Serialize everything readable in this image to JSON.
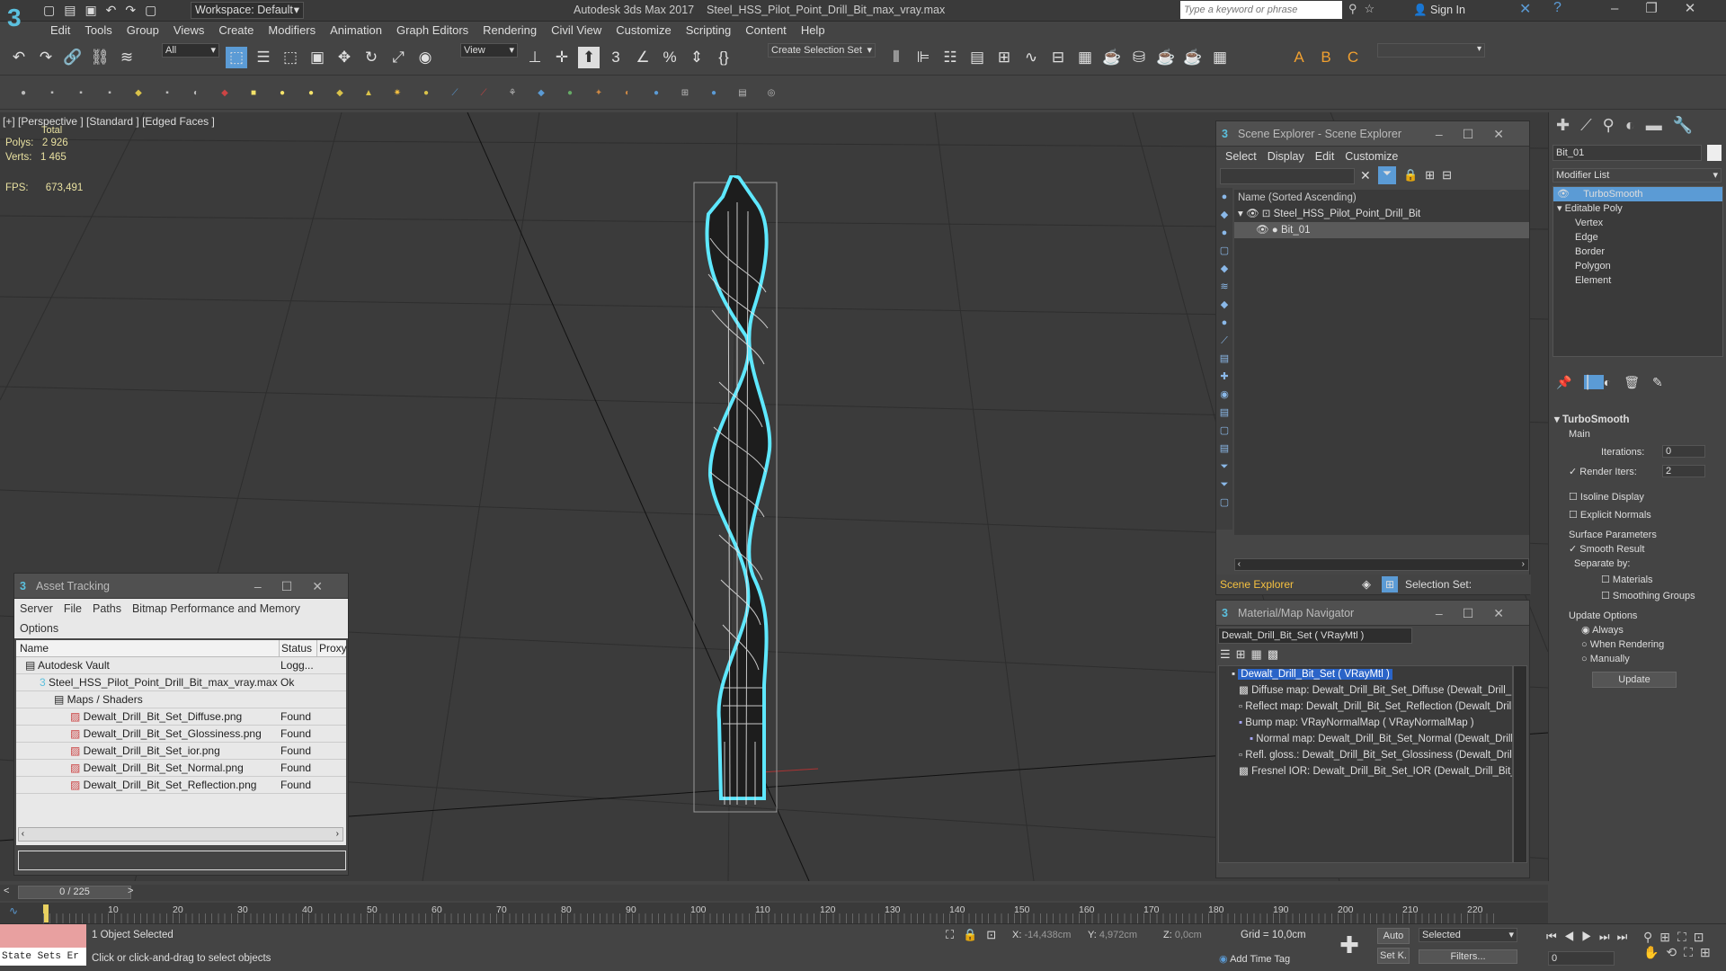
{
  "app": {
    "logo": "3",
    "workspace_label": "Workspace: Default",
    "title": "Autodesk 3ds Max 2017",
    "file": "Steel_HSS_Pilot_Point_Drill_Bit_max_vray.max",
    "search_placeholder": "Type a keyword or phrase",
    "signin": "Sign In"
  },
  "menu": [
    "Edit",
    "Tools",
    "Group",
    "Views",
    "Create",
    "Modifiers",
    "Animation",
    "Graph Editors",
    "Rendering",
    "Civil View",
    "Customize",
    "Scripting",
    "Content",
    "Help"
  ],
  "toolbar": {
    "filter": "All",
    "refcoord": "View",
    "selset": "Create Selection Set"
  },
  "viewport": {
    "label": "[+] [Perspective ]  [Standard ]  [Edged Faces ]",
    "total": "Total",
    "polys_label": "Polys:",
    "polys": "2 926",
    "verts_label": "Verts:",
    "verts": "1 465",
    "fps_label": "FPS:",
    "fps": "673,491"
  },
  "scene_explorer": {
    "title": "Scene Explorer - Scene Explorer",
    "menu": [
      "Select",
      "Display",
      "Edit",
      "Customize"
    ],
    "column": "Name (Sorted Ascending)",
    "items": [
      "Steel_HSS_Pilot_Point_Drill_Bit",
      "Bit_01"
    ],
    "footer": "Scene Explorer",
    "selection_set": "Selection Set:"
  },
  "material_nav": {
    "title": "Material/Map Navigator",
    "current": "Dewalt_Drill_Bit_Set  ( VRayMtl )",
    "root": "Dewalt_Drill_Bit_Set  ( VRayMtl )",
    "items": [
      "Diffuse map: Dewalt_Drill_Bit_Set_Diffuse (Dewalt_Drill_Bit_S",
      "Reflect map: Dewalt_Drill_Bit_Set_Reflection (Dewalt_Drill_Bi",
      "Bump map: VRayNormalMap  ( VRayNormalMap )",
      "Normal map: Dewalt_Drill_Bit_Set_Normal (Dewalt_Drill_Bit",
      "Refl. gloss.: Dewalt_Drill_Bit_Set_Glossiness (Dewalt_Drill_Bit",
      "Fresnel IOR: Dewalt_Drill_Bit_Set_IOR (Dewalt_Drill_Bit_Set_"
    ]
  },
  "asset_tracking": {
    "title": "Asset Tracking",
    "menu": [
      "Server",
      "File",
      "Paths",
      "Bitmap Performance and Memory",
      "Options"
    ],
    "columns": [
      "Name",
      "Status",
      "Proxy"
    ],
    "rows": [
      {
        "name": "Autodesk Vault",
        "status": "Logg..."
      },
      {
        "name": "Steel_HSS_Pilot_Point_Drill_Bit_max_vray.max",
        "status": "Ok"
      },
      {
        "name": "Maps / Shaders",
        "status": ""
      },
      {
        "name": "Dewalt_Drill_Bit_Set_Diffuse.png",
        "status": "Found"
      },
      {
        "name": "Dewalt_Drill_Bit_Set_Glossiness.png",
        "status": "Found"
      },
      {
        "name": "Dewalt_Drill_Bit_Set_ior.png",
        "status": "Found"
      },
      {
        "name": "Dewalt_Drill_Bit_Set_Normal.png",
        "status": "Found"
      },
      {
        "name": "Dewalt_Drill_Bit_Set_Reflection.png",
        "status": "Found"
      }
    ]
  },
  "command_panel": {
    "object_name": "Bit_01",
    "modifier_list": "Modifier List",
    "stack": [
      "TurboSmooth",
      "Editable Poly",
      "Vertex",
      "Edge",
      "Border",
      "Polygon",
      "Element"
    ],
    "rollout": "TurboSmooth",
    "main": "Main",
    "iterations_label": "Iterations:",
    "iterations": "0",
    "render_iters_label": "Render Iters:",
    "render_iters": "2",
    "isoline": "Isoline Display",
    "explicit": "Explicit Normals",
    "surface": "Surface Parameters",
    "smooth_result": "Smooth Result",
    "separate": "Separate by:",
    "materials": "Materials",
    "smoothing_groups": "Smoothing Groups",
    "update_options": "Update Options",
    "always": "Always",
    "when_rendering": "When Rendering",
    "manually": "Manually",
    "update": "Update"
  },
  "timeline": {
    "frame": "0 / 225",
    "ticks": [
      "10",
      "20",
      "30",
      "40",
      "50",
      "60",
      "70",
      "80",
      "90",
      "100",
      "110",
      "120",
      "130",
      "140",
      "150",
      "160",
      "170",
      "180",
      "190",
      "200",
      "210",
      "220"
    ]
  },
  "status": {
    "state_sets": "State Sets Er",
    "selected": "1 Object Selected",
    "hint": "Click or click-and-drag to select objects",
    "x_label": "X:",
    "x": "-14,438cm",
    "y_label": "Y:",
    "y": "4,972cm",
    "z_label": "Z:",
    "z": "0,0cm",
    "grid": "Grid = 10,0cm",
    "add_time_tag": "Add Time Tag",
    "auto": "Auto",
    "set_k": "Set K.",
    "selected_dd": "Selected",
    "filters": "Filters...",
    "frame_field": "0"
  },
  "colors": {
    "accent": "#5b9bd5",
    "wire": "#5ee8ff",
    "stats": "#e8e0a0"
  }
}
